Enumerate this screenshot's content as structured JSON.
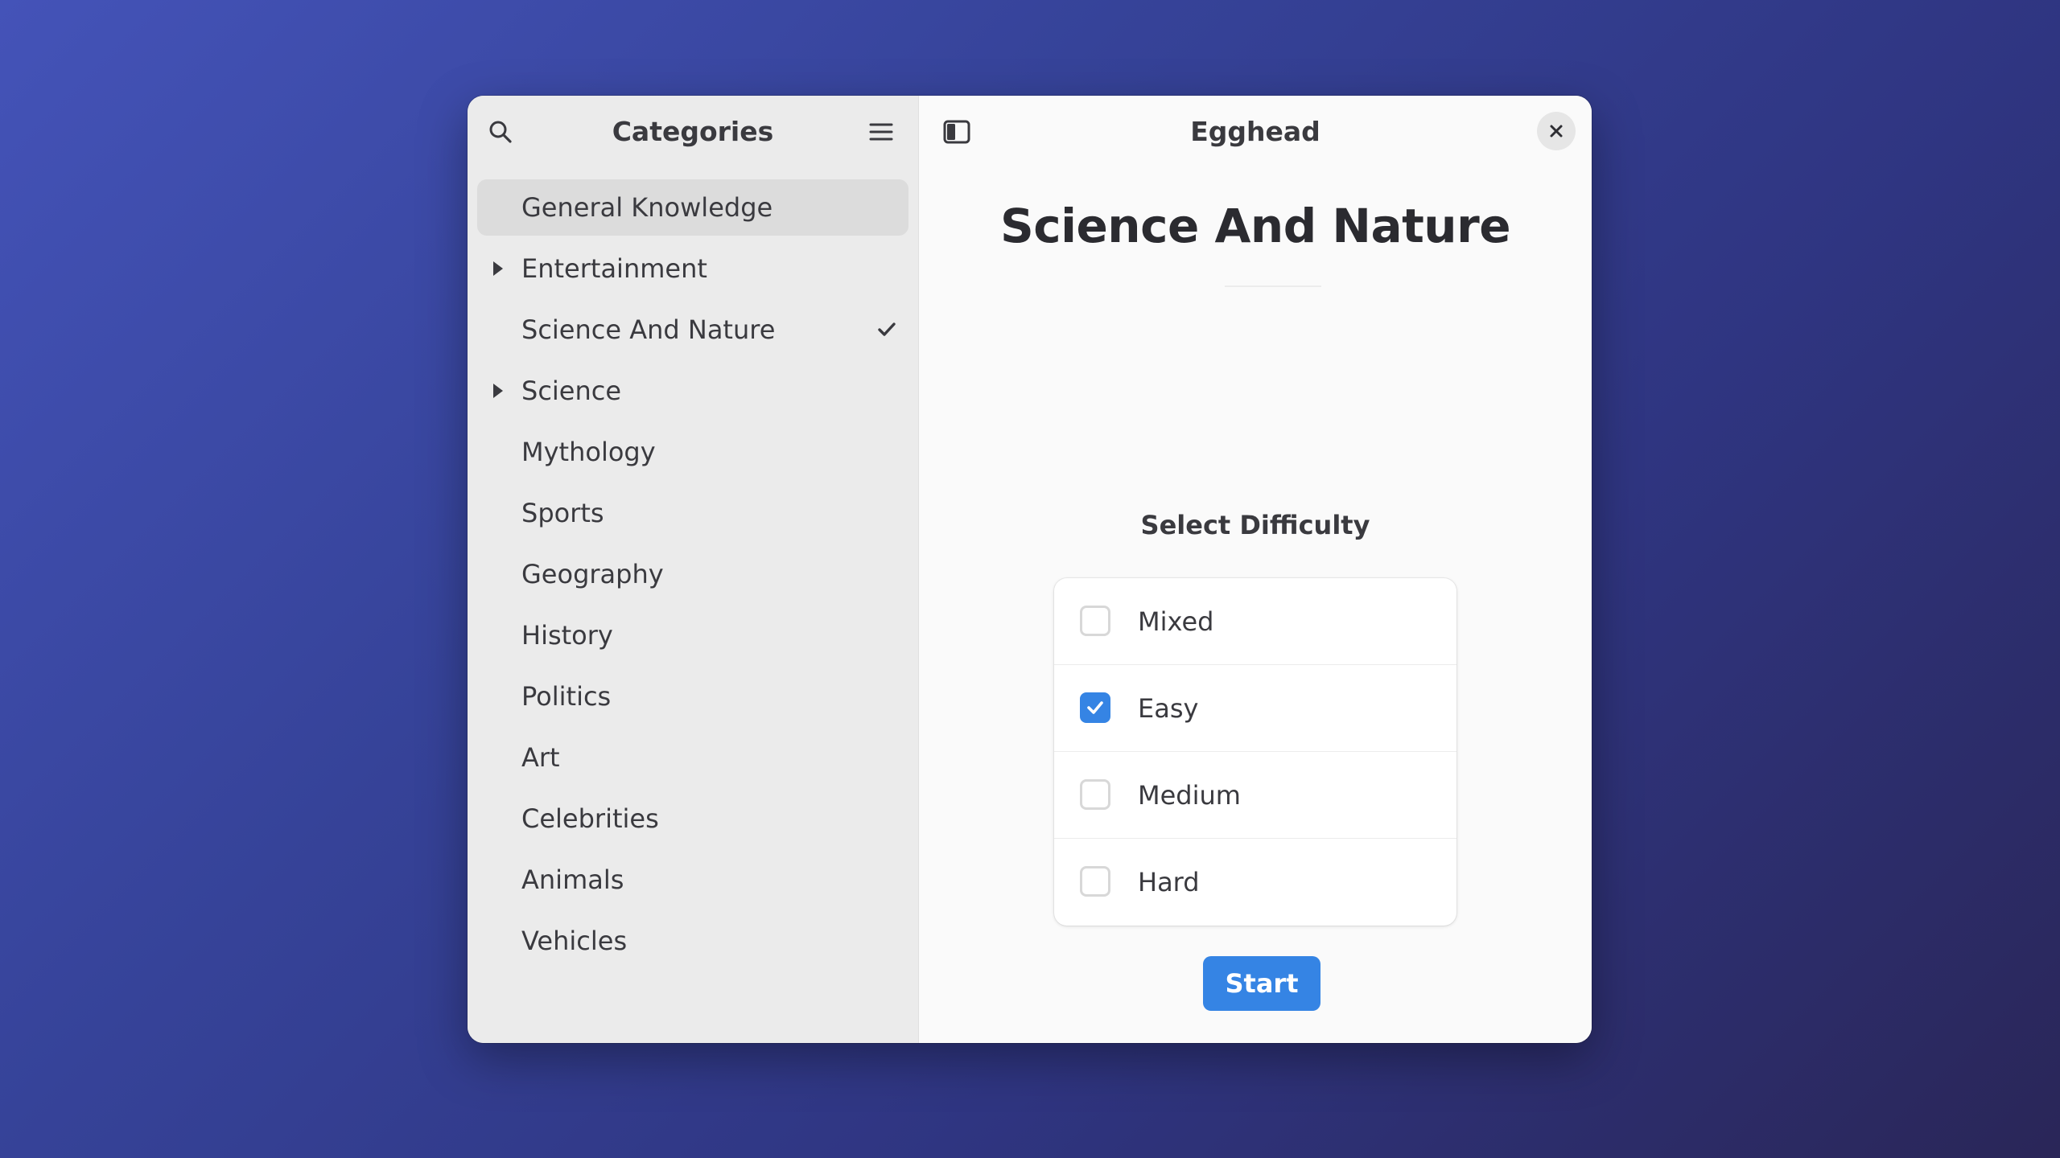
{
  "sidebar": {
    "title": "Categories",
    "search_icon": "search-icon",
    "menu_icon": "hamburger-menu-icon",
    "items": [
      {
        "label": "General Knowledge",
        "expandable": false,
        "selected": true,
        "checked": false
      },
      {
        "label": "Entertainment",
        "expandable": true,
        "selected": false,
        "checked": false
      },
      {
        "label": "Science And Nature",
        "expandable": false,
        "selected": false,
        "checked": true
      },
      {
        "label": "Science",
        "expandable": true,
        "selected": false,
        "checked": false
      },
      {
        "label": "Mythology",
        "expandable": false,
        "selected": false,
        "checked": false
      },
      {
        "label": "Sports",
        "expandable": false,
        "selected": false,
        "checked": false
      },
      {
        "label": "Geography",
        "expandable": false,
        "selected": false,
        "checked": false
      },
      {
        "label": "History",
        "expandable": false,
        "selected": false,
        "checked": false
      },
      {
        "label": "Politics",
        "expandable": false,
        "selected": false,
        "checked": false
      },
      {
        "label": "Art",
        "expandable": false,
        "selected": false,
        "checked": false
      },
      {
        "label": "Celebrities",
        "expandable": false,
        "selected": false,
        "checked": false
      },
      {
        "label": "Animals",
        "expandable": false,
        "selected": false,
        "checked": false
      },
      {
        "label": "Vehicles",
        "expandable": false,
        "selected": false,
        "checked": false
      }
    ]
  },
  "header": {
    "title": "Egghead",
    "sidebar_toggle_icon": "sidebar-toggle-icon",
    "close_icon": "close-icon"
  },
  "main": {
    "category_title": "Science And Nature",
    "difficulty_heading": "Select Difficulty",
    "difficulties": [
      {
        "label": "Mixed",
        "checked": false
      },
      {
        "label": "Easy",
        "checked": true
      },
      {
        "label": "Medium",
        "checked": false
      },
      {
        "label": "Hard",
        "checked": false
      }
    ],
    "start_label": "Start"
  },
  "colors": {
    "accent": "#3584e4",
    "background_gradient_start": "#4453b8",
    "background_gradient_end": "#2a2658",
    "sidebar_bg": "#ebebeb",
    "content_bg": "#fafafa"
  }
}
